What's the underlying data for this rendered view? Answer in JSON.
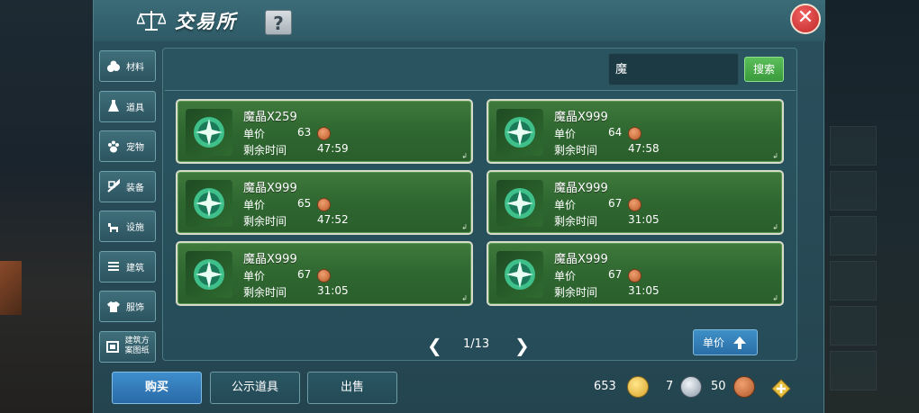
{
  "header": {
    "title": "交易所",
    "help_label": "?",
    "close_label": "✕"
  },
  "tabs": [
    {
      "label": "材料",
      "icon": "materials-icon"
    },
    {
      "label": "道具",
      "icon": "item-flask-icon"
    },
    {
      "label": "宠物",
      "icon": "paw-icon"
    },
    {
      "label": "装备",
      "icon": "sword-icon"
    },
    {
      "label": "设施",
      "icon": "animal-icon"
    },
    {
      "label": "建筑",
      "icon": "building-icon"
    },
    {
      "label": "服饰",
      "icon": "shirt-icon"
    },
    {
      "label": "建筑方案图纸",
      "icon": "blueprint-icon"
    }
  ],
  "search": {
    "value": "魔",
    "button_label": "搜索"
  },
  "listings": [
    {
      "name": "魔晶X259",
      "price_label": "单价",
      "price": "63",
      "time_label": "剩余时间",
      "time": "47:59"
    },
    {
      "name": "魔晶X999",
      "price_label": "单价",
      "price": "64",
      "time_label": "剩余时间",
      "time": "47:58"
    },
    {
      "name": "魔晶X999",
      "price_label": "单价",
      "price": "65",
      "time_label": "剩余时间",
      "time": "47:52"
    },
    {
      "name": "魔晶X999",
      "price_label": "单价",
      "price": "67",
      "time_label": "剩余时间",
      "time": "31:05"
    },
    {
      "name": "魔晶X999",
      "price_label": "单价",
      "price": "67",
      "time_label": "剩余时间",
      "time": "31:05"
    },
    {
      "name": "魔晶X999",
      "price_label": "单价",
      "price": "67",
      "time_label": "剩余时间",
      "time": "31:05"
    }
  ],
  "pagination": {
    "page": "1/13",
    "prev": "❮",
    "next": "❯"
  },
  "sort": {
    "label": "单价"
  },
  "bottom": {
    "buy": "购买",
    "public": "公示道具",
    "sell": "出售"
  },
  "currency": {
    "gold": "653",
    "silver": "7",
    "copper": "50"
  },
  "colors": {
    "item_bg": "#2f6730",
    "accent_blue": "#2a6ea6",
    "search_green": "#3a9a3c"
  }
}
